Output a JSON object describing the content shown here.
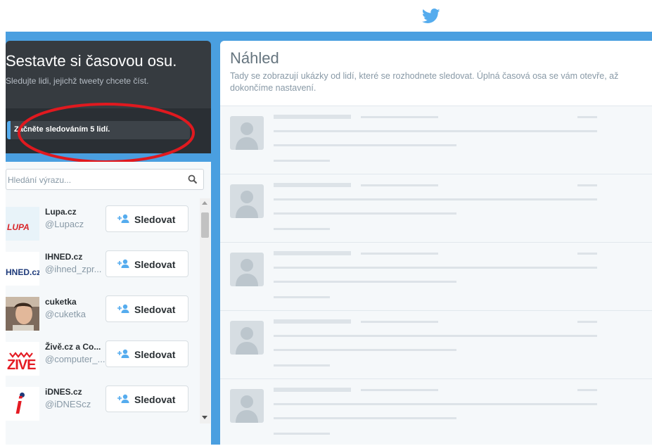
{
  "colors": {
    "twitter_blue": "#55acee",
    "page_bg": "#4a9fe0",
    "dark_panel": "#363b40",
    "annotation_red": "#e0191f"
  },
  "header": {
    "logo_icon": "twitter-bird-icon"
  },
  "onboarding": {
    "title": "Sestavte si časovou osu.",
    "subtitle": "Sledujte lidi, jejichž tweety chcete číst.",
    "progress_text": "Začněte sledováním 5 lidí.",
    "progress_fraction": 0.02
  },
  "search": {
    "placeholder": "Hledání výrazu...",
    "icon": "search-icon"
  },
  "suggestions": [
    {
      "name": "Lupa.cz",
      "handle": "@Lupacz",
      "follow_label": "Sledovat",
      "avatar_text": "LUPA"
    },
    {
      "name": "IHNED.cz",
      "handle": "@ihned_zpr...",
      "follow_label": "Sledovat",
      "avatar_text": "HNED.cz"
    },
    {
      "name": "cuketka",
      "handle": "@cuketka",
      "follow_label": "Sledovat",
      "avatar_text": ""
    },
    {
      "name": "Živě.cz a Co...",
      "handle": "@computer_...",
      "follow_label": "Sledovat",
      "avatar_text": "ZIVE"
    },
    {
      "name": "iDNES.cz",
      "handle": "@iDNEScz",
      "follow_label": "Sledovat",
      "avatar_text": "i"
    }
  ],
  "preview": {
    "title": "Náhled",
    "description": "Tady se zobrazují ukázky od lidí, které se rozhodnete sledovat. Úplná časová osa se vám otevře, až dokončíme nastavení."
  }
}
